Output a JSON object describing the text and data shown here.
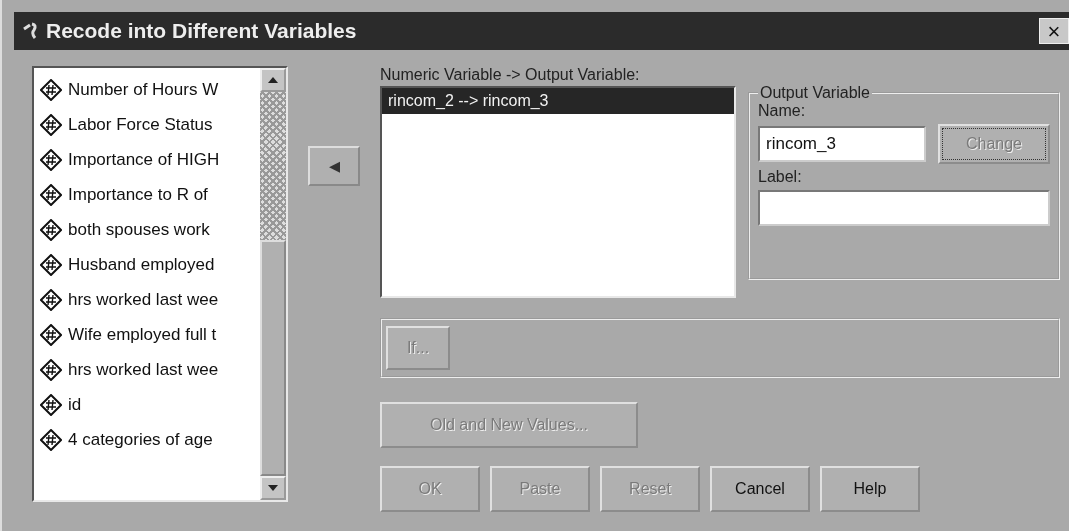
{
  "window": {
    "title": "Recode into Different Variables",
    "close": "×"
  },
  "variables": [
    {
      "label": "Number of Hours W",
      "selected": false
    },
    {
      "label": "Labor Force Status",
      "selected": false
    },
    {
      "label": "Importance of HIGH",
      "selected": false
    },
    {
      "label": "Importance to R of",
      "selected": false
    },
    {
      "label": "both spouses work",
      "selected": false
    },
    {
      "label": "Husband employed",
      "selected": false
    },
    {
      "label": "hrs worked last wee",
      "selected": false
    },
    {
      "label": "Wife employed full t",
      "selected": false
    },
    {
      "label": "hrs worked last wee",
      "selected": false
    },
    {
      "label": "id",
      "selected": false
    },
    {
      "label": "4 categories of age",
      "selected": false
    }
  ],
  "move_button": {
    "symbol": "◂"
  },
  "mapping": {
    "label": "Numeric Variable -> Output Variable:",
    "items": [
      {
        "label": "rincom_2 --> rincom_3",
        "selected": true
      }
    ]
  },
  "output_variable": {
    "title": "Output Variable",
    "name_label": "Name:",
    "name_value": "rincom_3",
    "change": {
      "label": "Change",
      "disabled": true
    },
    "label_label": "Label:"
  },
  "if_button": {
    "label": "If...",
    "disabled": true
  },
  "old_new_button": {
    "label": "Old and New Values...",
    "disabled": true
  },
  "buttons": [
    {
      "label": "OK",
      "disabled": true
    },
    {
      "label": "Paste",
      "disabled": true
    },
    {
      "label": "Reset",
      "disabled": true
    },
    {
      "label": "Cancel",
      "disabled": false
    },
    {
      "label": "Help",
      "disabled": false
    }
  ]
}
